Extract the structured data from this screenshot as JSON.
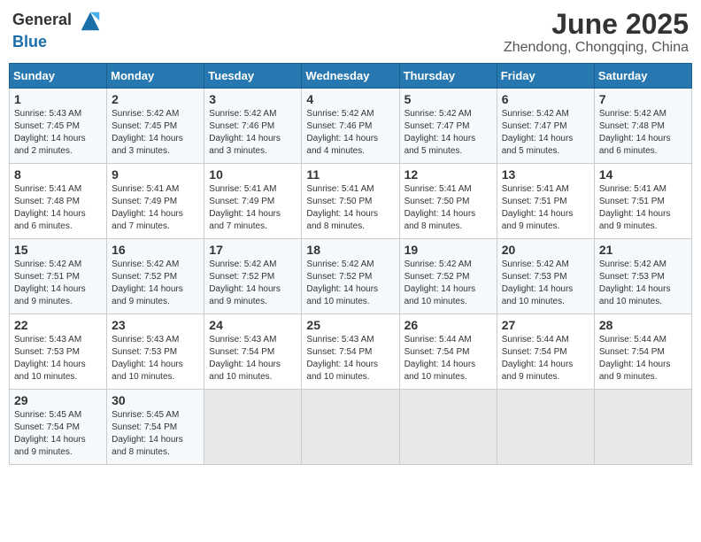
{
  "header": {
    "logo_general": "General",
    "logo_blue": "Blue",
    "month_title": "June 2025",
    "subtitle": "Zhendong, Chongqing, China"
  },
  "calendar": {
    "days_of_week": [
      "Sunday",
      "Monday",
      "Tuesday",
      "Wednesday",
      "Thursday",
      "Friday",
      "Saturday"
    ],
    "weeks": [
      [
        {
          "day": 1,
          "info": "Sunrise: 5:43 AM\nSunset: 7:45 PM\nDaylight: 14 hours\nand 2 minutes."
        },
        {
          "day": 2,
          "info": "Sunrise: 5:42 AM\nSunset: 7:45 PM\nDaylight: 14 hours\nand 3 minutes."
        },
        {
          "day": 3,
          "info": "Sunrise: 5:42 AM\nSunset: 7:46 PM\nDaylight: 14 hours\nand 3 minutes."
        },
        {
          "day": 4,
          "info": "Sunrise: 5:42 AM\nSunset: 7:46 PM\nDaylight: 14 hours\nand 4 minutes."
        },
        {
          "day": 5,
          "info": "Sunrise: 5:42 AM\nSunset: 7:47 PM\nDaylight: 14 hours\nand 5 minutes."
        },
        {
          "day": 6,
          "info": "Sunrise: 5:42 AM\nSunset: 7:47 PM\nDaylight: 14 hours\nand 5 minutes."
        },
        {
          "day": 7,
          "info": "Sunrise: 5:42 AM\nSunset: 7:48 PM\nDaylight: 14 hours\nand 6 minutes."
        }
      ],
      [
        {
          "day": 8,
          "info": "Sunrise: 5:41 AM\nSunset: 7:48 PM\nDaylight: 14 hours\nand 6 minutes."
        },
        {
          "day": 9,
          "info": "Sunrise: 5:41 AM\nSunset: 7:49 PM\nDaylight: 14 hours\nand 7 minutes."
        },
        {
          "day": 10,
          "info": "Sunrise: 5:41 AM\nSunset: 7:49 PM\nDaylight: 14 hours\nand 7 minutes."
        },
        {
          "day": 11,
          "info": "Sunrise: 5:41 AM\nSunset: 7:50 PM\nDaylight: 14 hours\nand 8 minutes."
        },
        {
          "day": 12,
          "info": "Sunrise: 5:41 AM\nSunset: 7:50 PM\nDaylight: 14 hours\nand 8 minutes."
        },
        {
          "day": 13,
          "info": "Sunrise: 5:41 AM\nSunset: 7:51 PM\nDaylight: 14 hours\nand 9 minutes."
        },
        {
          "day": 14,
          "info": "Sunrise: 5:41 AM\nSunset: 7:51 PM\nDaylight: 14 hours\nand 9 minutes."
        }
      ],
      [
        {
          "day": 15,
          "info": "Sunrise: 5:42 AM\nSunset: 7:51 PM\nDaylight: 14 hours\nand 9 minutes."
        },
        {
          "day": 16,
          "info": "Sunrise: 5:42 AM\nSunset: 7:52 PM\nDaylight: 14 hours\nand 9 minutes."
        },
        {
          "day": 17,
          "info": "Sunrise: 5:42 AM\nSunset: 7:52 PM\nDaylight: 14 hours\nand 9 minutes."
        },
        {
          "day": 18,
          "info": "Sunrise: 5:42 AM\nSunset: 7:52 PM\nDaylight: 14 hours\nand 10 minutes."
        },
        {
          "day": 19,
          "info": "Sunrise: 5:42 AM\nSunset: 7:52 PM\nDaylight: 14 hours\nand 10 minutes."
        },
        {
          "day": 20,
          "info": "Sunrise: 5:42 AM\nSunset: 7:53 PM\nDaylight: 14 hours\nand 10 minutes."
        },
        {
          "day": 21,
          "info": "Sunrise: 5:42 AM\nSunset: 7:53 PM\nDaylight: 14 hours\nand 10 minutes."
        }
      ],
      [
        {
          "day": 22,
          "info": "Sunrise: 5:43 AM\nSunset: 7:53 PM\nDaylight: 14 hours\nand 10 minutes."
        },
        {
          "day": 23,
          "info": "Sunrise: 5:43 AM\nSunset: 7:53 PM\nDaylight: 14 hours\nand 10 minutes."
        },
        {
          "day": 24,
          "info": "Sunrise: 5:43 AM\nSunset: 7:54 PM\nDaylight: 14 hours\nand 10 minutes."
        },
        {
          "day": 25,
          "info": "Sunrise: 5:43 AM\nSunset: 7:54 PM\nDaylight: 14 hours\nand 10 minutes."
        },
        {
          "day": 26,
          "info": "Sunrise: 5:44 AM\nSunset: 7:54 PM\nDaylight: 14 hours\nand 10 minutes."
        },
        {
          "day": 27,
          "info": "Sunrise: 5:44 AM\nSunset: 7:54 PM\nDaylight: 14 hours\nand 9 minutes."
        },
        {
          "day": 28,
          "info": "Sunrise: 5:44 AM\nSunset: 7:54 PM\nDaylight: 14 hours\nand 9 minutes."
        }
      ],
      [
        {
          "day": 29,
          "info": "Sunrise: 5:45 AM\nSunset: 7:54 PM\nDaylight: 14 hours\nand 9 minutes."
        },
        {
          "day": 30,
          "info": "Sunrise: 5:45 AM\nSunset: 7:54 PM\nDaylight: 14 hours\nand 8 minutes."
        },
        null,
        null,
        null,
        null,
        null
      ]
    ]
  }
}
